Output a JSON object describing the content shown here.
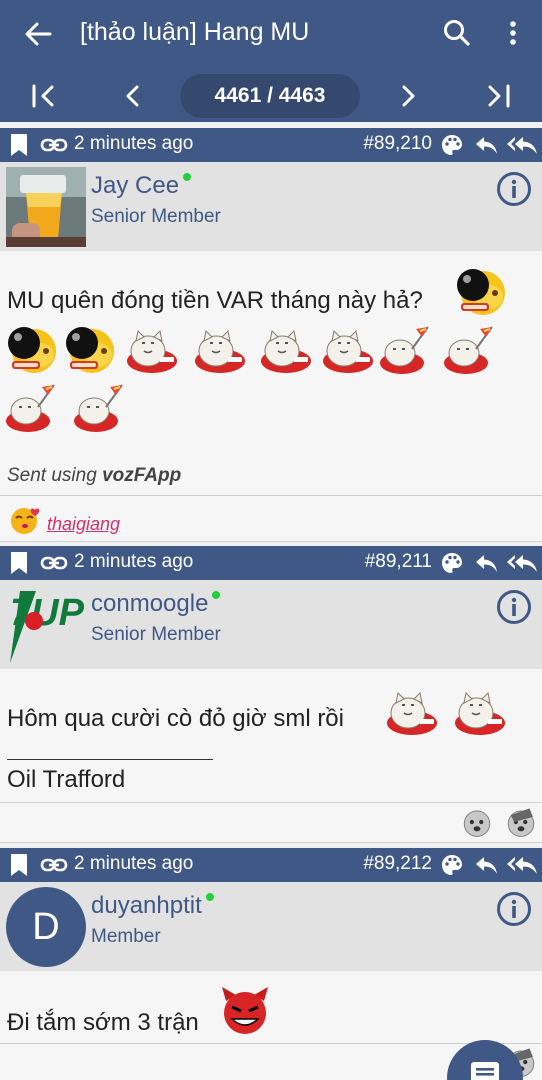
{
  "appbar": {
    "title": "[thảo luận] Hang MU",
    "page_indicator": "4461 / 4463"
  },
  "posts": [
    {
      "time": "2 minutes ago",
      "number": "#89,210",
      "author": "Jay Cee",
      "rank": "Senior Member",
      "text": "MU quên đóng tiền VAR tháng này hả?",
      "signature_prefix": "Sent using ",
      "signature_app": "vozFApp",
      "reaction_user": "thaigiang"
    },
    {
      "time": "2 minutes ago",
      "number": "#89,211",
      "author": "conmoogle",
      "rank": "Senior Member",
      "logo_text": "7UP",
      "text": "Hôm qua cười cò đỏ giờ sml rồi",
      "signature": "Oil Trafford"
    },
    {
      "time": "2 minutes ago",
      "number": "#89,212",
      "author": "duyanhptit",
      "rank": "Member",
      "avatar_letter": "D",
      "text": "Đi tắm sớm 3 trận"
    }
  ],
  "colors": {
    "header_blue": "#3f5886",
    "author_bg": "#e2e2e2",
    "body_bg": "#f6f6f6",
    "online": "#22d13a",
    "reaction_link": "#d0306c"
  },
  "icons": [
    "back-arrow-icon",
    "search-icon",
    "more-vert-icon",
    "first-page-icon",
    "prev-page-icon",
    "next-page-icon",
    "last-page-icon",
    "bookmark-icon",
    "link-icon",
    "palette-icon",
    "reply-icon",
    "reply-all-icon",
    "info-icon",
    "comment-icon"
  ]
}
